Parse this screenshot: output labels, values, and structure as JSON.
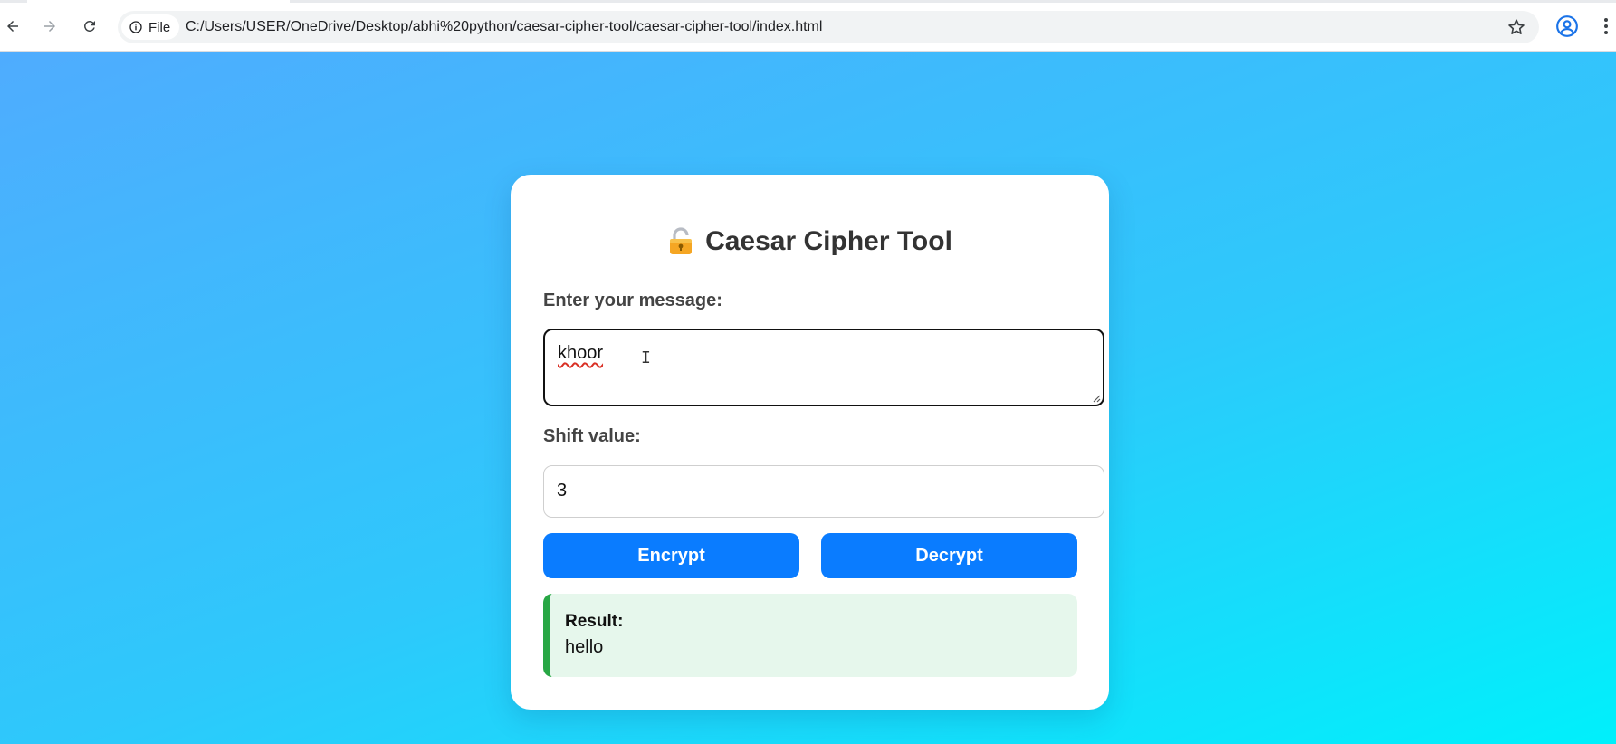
{
  "browser": {
    "site_chip_label": "File",
    "url": "C:/Users/USER/OneDrive/Desktop/abhi%20python/caesar-cipher-tool/caesar-cipher-tool/index.html",
    "icons": {
      "back": "back-arrow-icon",
      "forward": "forward-arrow-icon",
      "reload": "reload-icon",
      "site_info": "info-icon",
      "bookmark": "star-icon",
      "profile": "profile-icon",
      "menu": "more-vert-icon"
    }
  },
  "page": {
    "title": "Caesar Cipher Tool",
    "title_icon": "lock-icon",
    "message_label": "Enter your message:",
    "message_value": "khoor",
    "shift_label": "Shift value:",
    "shift_value": "3",
    "encrypt_label": "Encrypt",
    "decrypt_label": "Decrypt",
    "result_label": "Result:",
    "result_value": "hello"
  },
  "colors": {
    "gradient_start": "#4facfe",
    "gradient_end": "#00f0fb",
    "button": "#0a7cff",
    "result_bg": "#e6f7ec",
    "result_border": "#28a745"
  }
}
